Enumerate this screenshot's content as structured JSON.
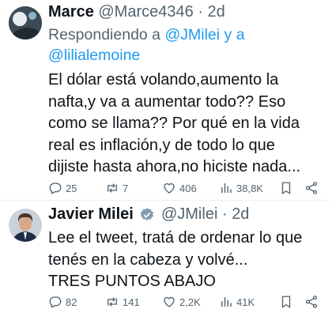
{
  "tweet1": {
    "display_name": "Marce",
    "handle": "@Marce4346",
    "separator": "·",
    "time": "2d",
    "reply_prefix": "Respondiendo a",
    "reply_to_1": "@JMilei",
    "reply_joiner": "y a",
    "reply_to_2": "@lilialemoine",
    "text_lines": [
      "El dólar está volando,aumento la",
      "nafta,y va a aumentar todo?? Eso",
      "como se llama?? Por qué en la vida",
      "real es inflación,y de todo lo que",
      "dijiste hasta ahora,no hiciste nada..."
    ],
    "replies": "25",
    "retweets": "7",
    "likes": "406",
    "views": "38,8K"
  },
  "tweet2": {
    "display_name": "Javier Milei",
    "handle": "@JMilei",
    "separator": "·",
    "time": "2d",
    "text_lines": [
      "Lee el tweet, tratá de ordenar lo que",
      "tenés en la cabeza y volvé...",
      "TRES PUNTOS ABAJO"
    ],
    "replies": "82",
    "retweets": "141",
    "likes": "2,2K",
    "views": "41K"
  },
  "icons": [
    "reply-icon",
    "retweet-icon",
    "like-icon",
    "views-icon",
    "bookmark-icon",
    "share-icon",
    "verified-badge-icon"
  ],
  "colors": {
    "link": "#1d9bf0",
    "muted": "#536471",
    "text": "#0f1419",
    "verified": "#829aab"
  }
}
